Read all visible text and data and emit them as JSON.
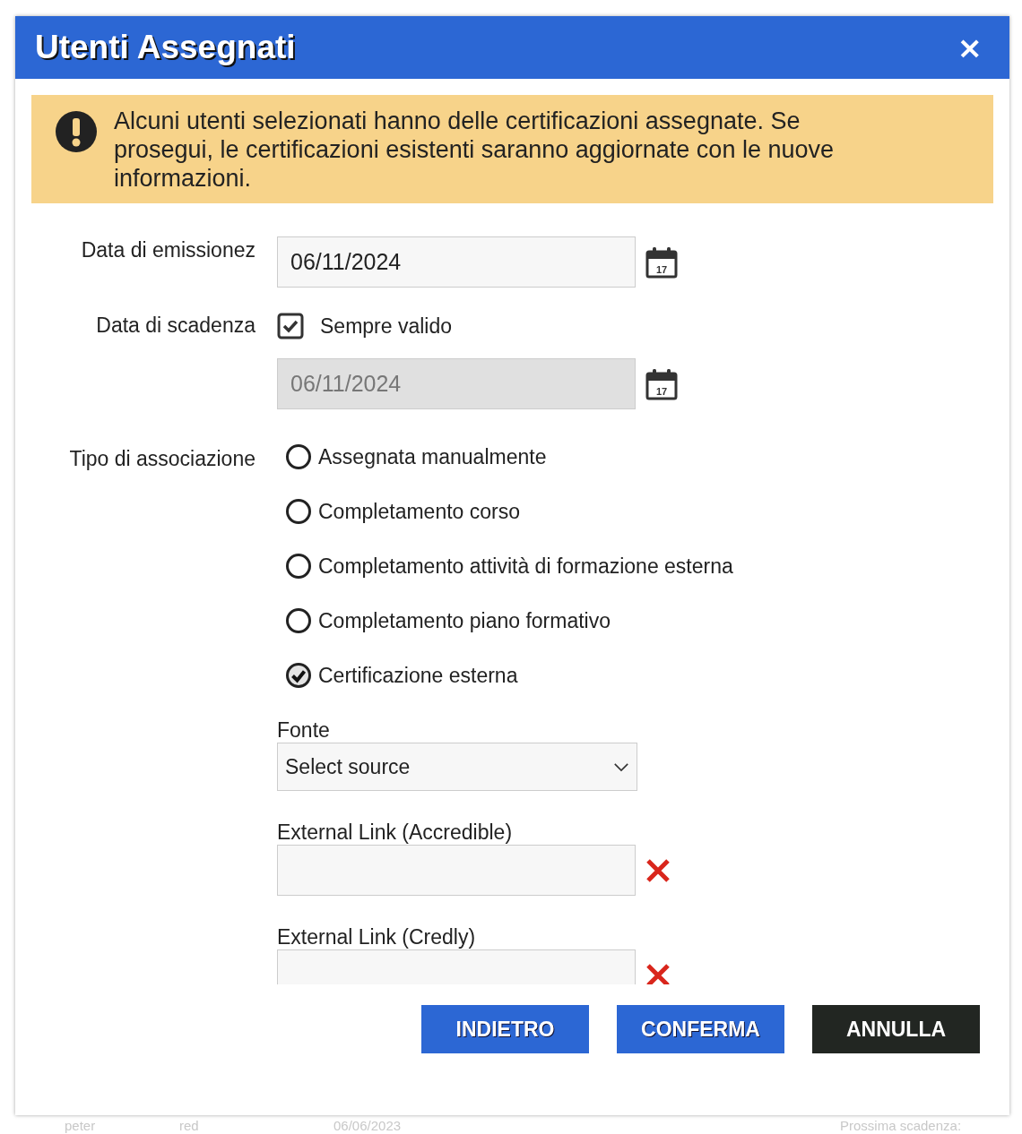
{
  "dialog": {
    "title": "Utenti Assegnati",
    "close": "×"
  },
  "alert": {
    "text": "Alcuni utenti selezionati hanno delle certificazioni assegnate. Se prosegui, le certificazioni esistenti saranno aggiornate con le nuove informazioni."
  },
  "issue_date": {
    "label": "Data di emissionez",
    "value": "06/11/2024",
    "disabled": false,
    "calendar_day": "17"
  },
  "expiry_date": {
    "label": "Data di scadenza",
    "always_valid": {
      "label": "Sempre valido",
      "checked": true
    },
    "value": "06/11/2024",
    "disabled": true,
    "calendar_day": "17"
  },
  "association": {
    "label": "Tipo di associazione",
    "options": [
      {
        "label": "Assegnata manualmente",
        "selected": false
      },
      {
        "label": "Completamento corso",
        "selected": false
      },
      {
        "label": "Completamento attività di formazione esterna",
        "selected": false
      },
      {
        "label": "Completamento piano formativo",
        "selected": false
      },
      {
        "label": "Certificazione esterna",
        "selected": true
      }
    ]
  },
  "source": {
    "label": "Fonte",
    "value": "Select source"
  },
  "links": [
    {
      "label": "External Link (Accredible)"
    },
    {
      "label": "External Link (Credly)"
    }
  ],
  "buttons": [
    {
      "label": "INDIETRO",
      "kind": "primary"
    },
    {
      "label": "CONFERMA",
      "kind": "primary"
    },
    {
      "label": "ANNULLA",
      "kind": "dark"
    }
  ],
  "background_row": [
    "peter",
    "red",
    "06/06/2023",
    "Prossima scadenza:"
  ]
}
